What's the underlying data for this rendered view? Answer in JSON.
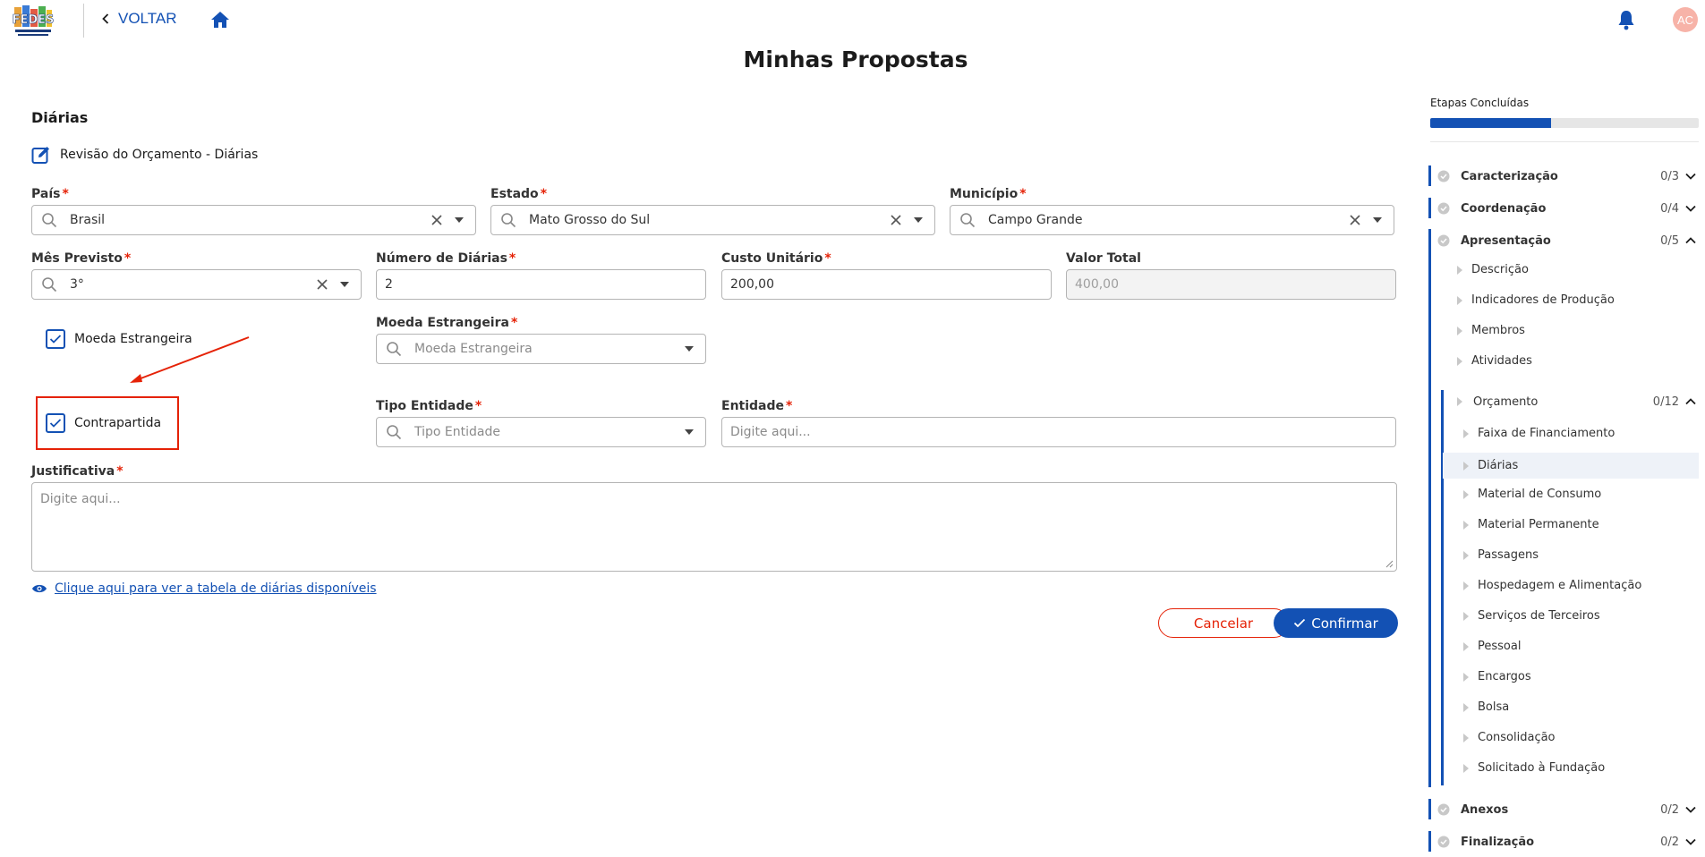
{
  "header": {
    "back_label": "VOLTAR",
    "avatar_initials": "AC",
    "logo_text": "FEDES"
  },
  "page": {
    "title": "Minhas Propostas"
  },
  "form": {
    "section_title": "Diárias",
    "subtitle": "Revisão do Orçamento - Diárias",
    "pais": {
      "label": "País",
      "value": "Brasil"
    },
    "estado": {
      "label": "Estado",
      "value": "Mato Grosso do Sul"
    },
    "municipio": {
      "label": "Município",
      "value": "Campo Grande"
    },
    "mes_previsto": {
      "label": "Mês Previsto",
      "value": "3°"
    },
    "numero_diarias": {
      "label": "Número de Diárias",
      "value": "2"
    },
    "custo_unitario": {
      "label": "Custo Unitário",
      "value": "200,00"
    },
    "valor_total": {
      "label": "Valor Total",
      "value": "400,00"
    },
    "moeda_checkbox": {
      "label": "Moeda Estrangeira",
      "checked": true
    },
    "moeda_estrangeira": {
      "label": "Moeda Estrangeira",
      "placeholder": "Moeda Estrangeira"
    },
    "contrapartida_checkbox": {
      "label": "Contrapartida",
      "checked": true
    },
    "tipo_entidade": {
      "label": "Tipo Entidade",
      "placeholder": "Tipo Entidade"
    },
    "entidade": {
      "label": "Entidade",
      "placeholder": "Digite aqui..."
    },
    "justificativa": {
      "label": "Justificativa",
      "placeholder": "Digite aqui..."
    },
    "required_mark": "*",
    "table_link": "Clique aqui para ver a tabela de diárias disponíveis",
    "cancel_label": "Cancelar",
    "confirm_label": "Confirmar"
  },
  "sidebar": {
    "title": "Etapas Concluídas",
    "progress": 0.45,
    "sections": [
      {
        "label": "Caracterização",
        "count": "0/3",
        "expanded": false
      },
      {
        "label": "Coordenação",
        "count": "0/4",
        "expanded": false
      },
      {
        "label": "Apresentação",
        "count": "0/5",
        "expanded": true
      },
      {
        "label": "Anexos",
        "count": "0/2",
        "expanded": false
      },
      {
        "label": "Finalização",
        "count": "0/2",
        "expanded": false
      }
    ],
    "apresentacao_items": [
      "Descrição",
      "Indicadores de Produção",
      "Membros",
      "Atividades"
    ],
    "orcamento": {
      "label": "Orçamento",
      "count": "0/12"
    },
    "orcamento_items": [
      "Faixa de Financiamento",
      "Diárias",
      "Material de Consumo",
      "Material Permanente",
      "Passagens",
      "Hospedagem e Alimentação",
      "Serviços de Terceiros",
      "Pessoal",
      "Encargos",
      "Bolsa",
      "Consolidação",
      "Solicitado à Fundação"
    ],
    "active_item": "Diárias"
  },
  "colors": {
    "primary": "#1351b4",
    "danger": "#e52207",
    "avatar": "#f7b3a8"
  }
}
